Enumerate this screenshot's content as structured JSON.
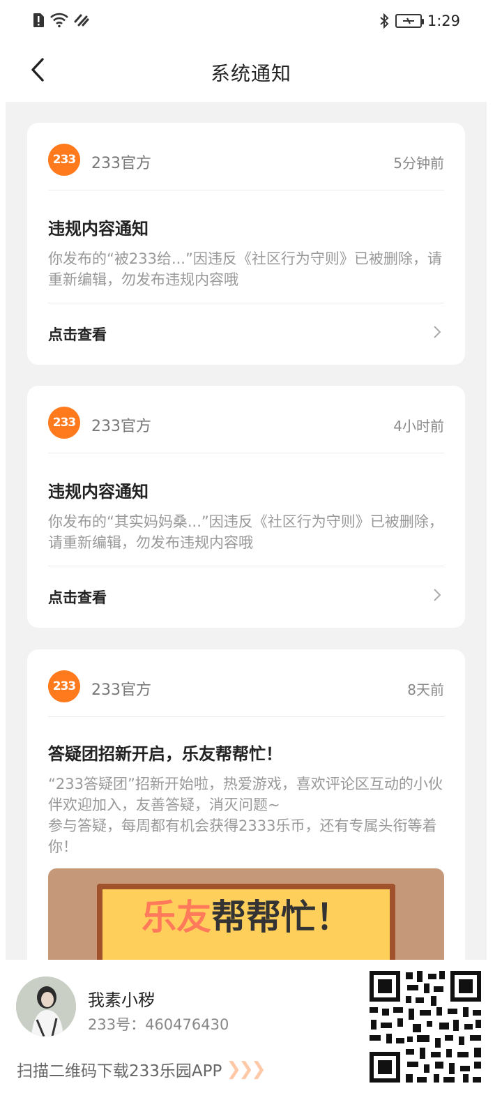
{
  "status": {
    "time": "1:29"
  },
  "nav": {
    "title": "系统通知"
  },
  "notices": [
    {
      "sender": "233官方",
      "avatar_text": "233",
      "time": "5分钟前",
      "title": "违规内容通知",
      "body": "你发布的“被233给...”因违反《社区行为守则》已被删除，请重新编辑，勿发布违规内容哦",
      "link": "点击查看"
    },
    {
      "sender": "233官方",
      "avatar_text": "233",
      "time": "4小时前",
      "title": "违规内容通知",
      "body": "你发布的“其实妈妈桑...”因违反《社区行为守则》已被删除，请重新编辑，勿发布违规内容哦",
      "link": "点击查看"
    },
    {
      "sender": "233官方",
      "avatar_text": "233",
      "time": "8天前",
      "title": "答疑团招新开启，乐友帮帮忙！",
      "body_lines": [
        "“233答疑团”招新开始啦，热爱游戏，喜欢评论区互动的小伙伴欢迎加入，友善答疑，消灭问题~",
        "参与答疑，每周都有机会获得2333乐币，还有专属头衔等着你！"
      ],
      "banner_text_1": "乐友",
      "banner_text_2": "帮帮忙！"
    }
  ],
  "footer": {
    "user_name": "我素小秽",
    "user_id": "233号：460476430",
    "scan_tip": "扫描二维码下载233乐园APP",
    "arrows": "❯❯❯"
  },
  "colors": {
    "accent": "#ff7a1c",
    "background": "#f2f2f2"
  }
}
